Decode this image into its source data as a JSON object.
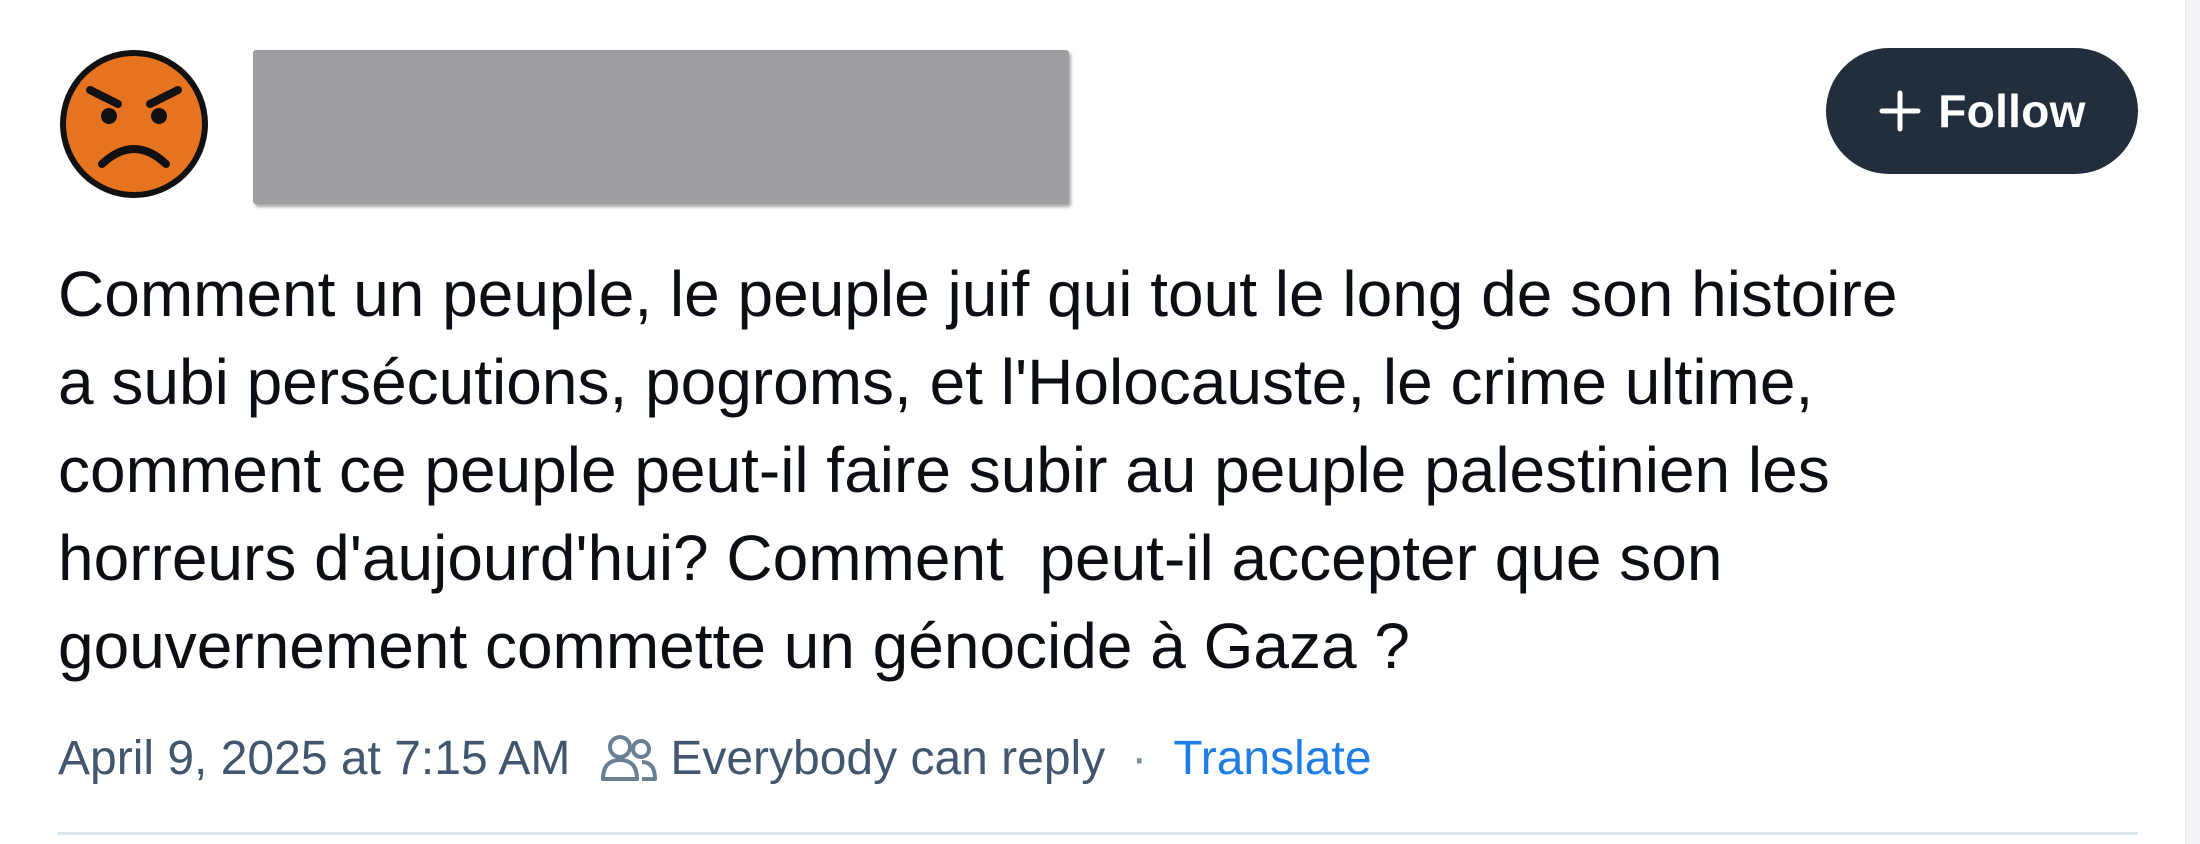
{
  "post": {
    "author": {
      "avatar_icon": "angry-face-icon",
      "avatar_color": "#e6731f"
    },
    "follow_label": "Follow",
    "follow_icon": "plus-icon",
    "text": "Comment un peuple, le peuple juif qui tout le long de son histoire\na subi persécutions, pogroms, et l'Holocauste, le crime ultime,\ncomment ce peuple peut-il faire subir au peuple palestinien les\nhorreurs d'aujourd'hui? Comment  peut-il accepter que son\ngouvernement commette un génocide à Gaza ?",
    "meta": {
      "timestamp": "April 9, 2025 at 7:15 AM",
      "reply_icon": "people-icon",
      "reply_setting": "Everybody can reply",
      "separator": "·",
      "translate_label": "Translate"
    }
  },
  "colors": {
    "follow_bg": "#222e3c",
    "link": "#1f7de6",
    "meta_text": "#42576e",
    "redaction": "#9d9da2"
  }
}
